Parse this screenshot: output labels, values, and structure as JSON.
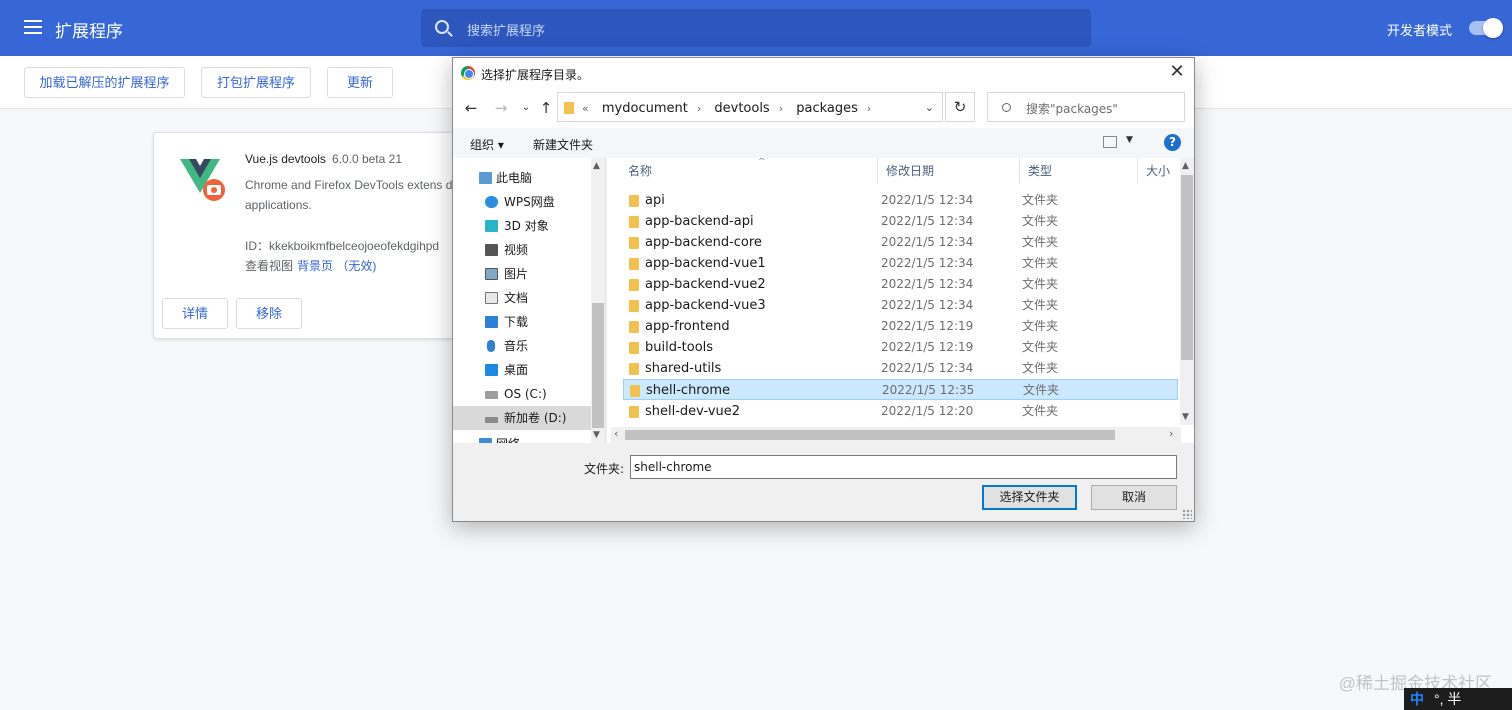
{
  "header": {
    "title": "扩展程序",
    "search_placeholder": "搜索扩展程序",
    "dev_mode_label": "开发者模式",
    "dev_mode_on": true
  },
  "toolbar": {
    "load_unpacked": "加载已解压的扩展程序",
    "pack": "打包扩展程序",
    "update": "更新"
  },
  "extension": {
    "name": "Vue.js devtools",
    "version": "6.0.0 beta 21",
    "description": "Chrome and Firefox DevTools extens debugging Vue.js applications.",
    "id": "ID：kkekboikmfbelceojoeofekdgihpd",
    "views_label": "查看视图",
    "views_link": "背景页 （无效)",
    "details_button": "详情",
    "remove_button": "移除"
  },
  "dialog": {
    "title": "选择扩展程序目录。",
    "close": "✕",
    "address": {
      "overflow": "«",
      "crumbs": [
        "mydocument",
        "devtools",
        "packages"
      ]
    },
    "search_placeholder": "搜索\"packages\"",
    "cmd_organize": "组织 ▾",
    "cmd_new_folder": "新建文件夹",
    "nav_items": [
      {
        "label": "此电脑",
        "icon": "computer-icon"
      },
      {
        "label": "WPS网盘",
        "icon": "cloud-icon"
      },
      {
        "label": "3D 对象",
        "icon": "cube-icon"
      },
      {
        "label": "视频",
        "icon": "video-icon"
      },
      {
        "label": "图片",
        "icon": "picture-icon"
      },
      {
        "label": "文档",
        "icon": "document-icon"
      },
      {
        "label": "下载",
        "icon": "download-icon"
      },
      {
        "label": "音乐",
        "icon": "music-icon"
      },
      {
        "label": "桌面",
        "icon": "desktop-icon"
      },
      {
        "label": "OS (C:)",
        "icon": "drive-icon"
      },
      {
        "label": "新加卷 (D:)",
        "icon": "drive-icon"
      },
      {
        "label": "网络",
        "icon": "network-icon"
      }
    ],
    "columns": {
      "name": "名称",
      "modified": "修改日期",
      "type": "类型",
      "size": "大小"
    },
    "files": [
      {
        "name": "api",
        "date": "2022/1/5 12:34",
        "type": "文件夹"
      },
      {
        "name": "app-backend-api",
        "date": "2022/1/5 12:34",
        "type": "文件夹"
      },
      {
        "name": "app-backend-core",
        "date": "2022/1/5 12:34",
        "type": "文件夹"
      },
      {
        "name": "app-backend-vue1",
        "date": "2022/1/5 12:34",
        "type": "文件夹"
      },
      {
        "name": "app-backend-vue2",
        "date": "2022/1/5 12:34",
        "type": "文件夹"
      },
      {
        "name": "app-backend-vue3",
        "date": "2022/1/5 12:34",
        "type": "文件夹"
      },
      {
        "name": "app-frontend",
        "date": "2022/1/5 12:19",
        "type": "文件夹"
      },
      {
        "name": "build-tools",
        "date": "2022/1/5 12:19",
        "type": "文件夹"
      },
      {
        "name": "shared-utils",
        "date": "2022/1/5 12:34",
        "type": "文件夹"
      },
      {
        "name": "shell-chrome",
        "date": "2022/1/5 12:35",
        "type": "文件夹",
        "selected": true
      },
      {
        "name": "shell-dev-vue2",
        "date": "2022/1/5 12:20",
        "type": "文件夹"
      }
    ],
    "folder_label": "文件夹:",
    "folder_value": "shell-chrome",
    "select_button": "选择文件夹",
    "cancel_button": "取消"
  },
  "watermark": "@稀土掘金技术社区",
  "ime": {
    "mode": "中",
    "rest": "°, 半"
  }
}
